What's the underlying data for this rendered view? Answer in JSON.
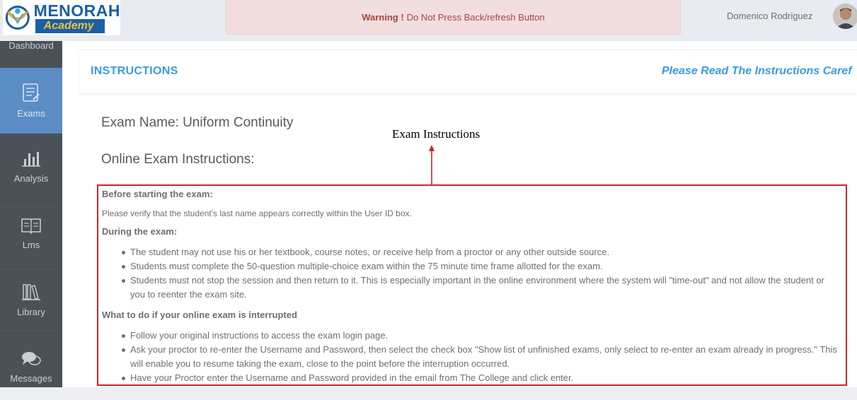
{
  "header": {
    "logo": {
      "title": "MENORAH",
      "subtitle": "Academy"
    },
    "warning": {
      "bold": "Warning !",
      "text": "Do Not Press Back/refresh Button"
    },
    "user_name": "Domenico Rodriguez"
  },
  "sidebar": {
    "top_label": "Dashboard",
    "items": [
      {
        "label": "Exams",
        "icon": "exams-icon",
        "active": true
      },
      {
        "label": "Analysis",
        "icon": "analysis-icon",
        "active": false
      },
      {
        "label": "Lms",
        "icon": "lms-icon",
        "active": false
      },
      {
        "label": "Library",
        "icon": "library-icon",
        "active": false
      },
      {
        "label": "Messages",
        "icon": "messages-icon",
        "active": false
      }
    ]
  },
  "panel": {
    "title": "INSTRUCTIONS",
    "note": "Please Read The Instructions Caref"
  },
  "exam": {
    "name": "Exam Name: Uniform Continuity",
    "online_title": "Online Exam Instructions:"
  },
  "annotation": {
    "label": "Exam Instructions"
  },
  "instructions": {
    "before_heading": "Before starting the exam:",
    "before_text": "Please verify that the student's last name appears correctly within the User ID box.",
    "during_heading": "During the exam:",
    "during_items": [
      "The student may not use his or her textbook, course notes, or receive help from a proctor or any other outside source.",
      "Students must complete the 50-question multiple-choice exam within the 75 minute time frame allotted for the exam.",
      "Students must not stop the session and then return to it. This is especially important in the online environment where the system will \"time-out\" and not allow the student or you to reenter the exam site."
    ],
    "interrupted_heading": "What to do if your online exam is interrupted",
    "interrupted_items": [
      "Follow your original instructions to access the exam login page.",
      "Ask your proctor to re-enter the Username and Password, then select the check box \"Show list of unfinished exams, only select to re-enter an exam already in progress.\" This will enable you to resume taking the exam, close to the point before the interruption occurred.",
      "Have your Proctor enter the Username and Password provided in the email from The College and click enter."
    ]
  },
  "colors": {
    "accent": "#3c9be0",
    "sidebar": "#4a5258",
    "sidebar_active": "#5b8dc4",
    "warning_bg": "#f2dede",
    "warning_text": "#a94442",
    "annotation": "#d3222a"
  }
}
